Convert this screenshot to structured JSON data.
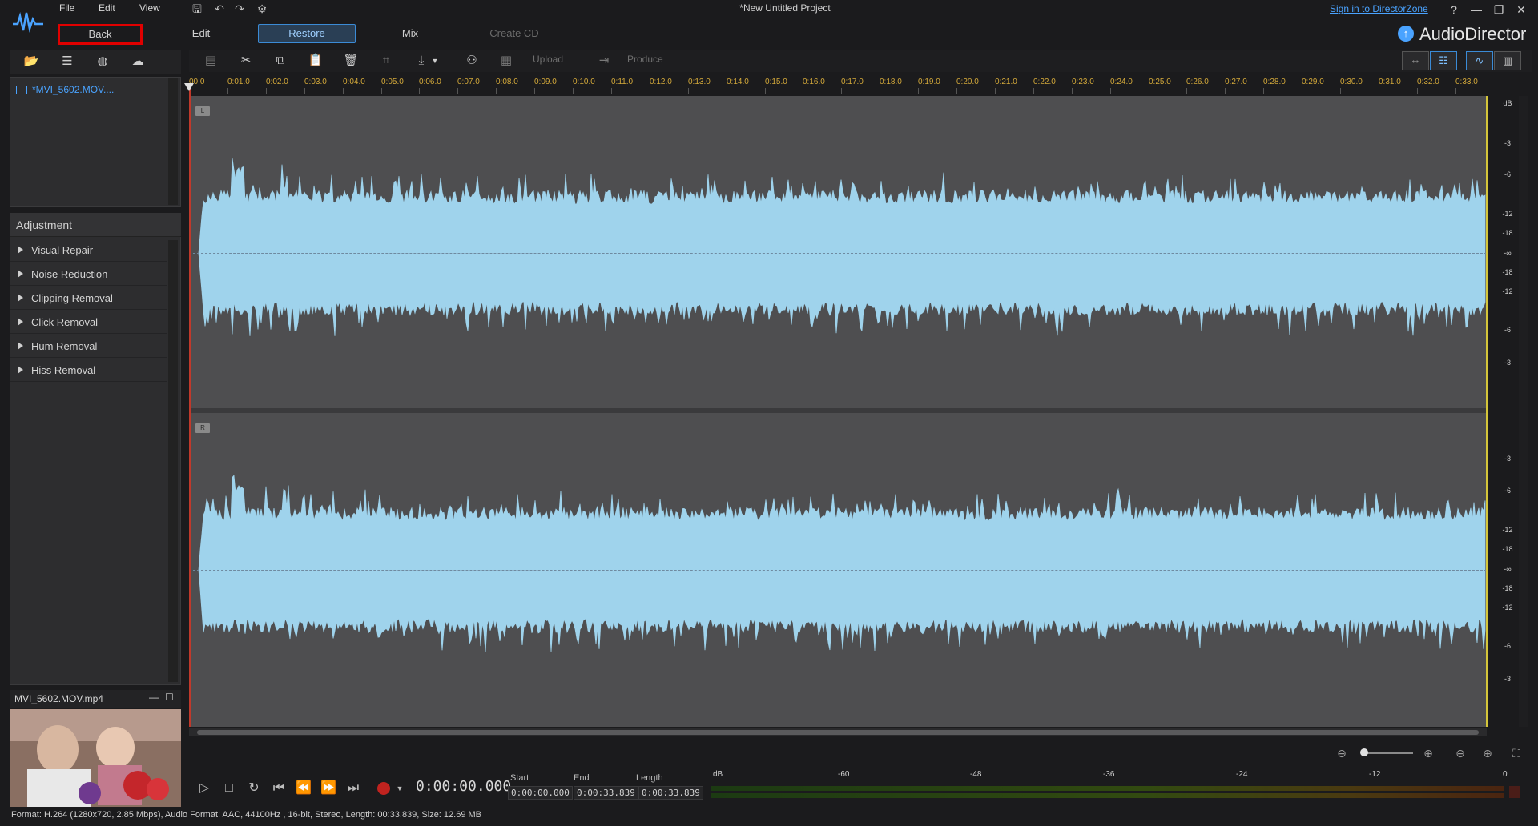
{
  "app": {
    "menu": [
      "File",
      "Edit",
      "View"
    ],
    "project_title": "*New Untitled Project",
    "sign_in": "Sign in to DirectorZone",
    "help": "?",
    "brand": "AudioDirector"
  },
  "modes": {
    "back": "Back",
    "edit": "Edit",
    "restore": "Restore",
    "mix": "Mix",
    "create_cd": "Create CD"
  },
  "library": {
    "item": "*MVI_5602.MOV...."
  },
  "adjustment": {
    "header": "Adjustment",
    "items": [
      "Visual Repair",
      "Noise Reduction",
      "Clipping Removal",
      "Click Removal",
      "Hum Removal",
      "Hiss Removal"
    ]
  },
  "preview": {
    "filename": "MVI_5602.MOV.mp4"
  },
  "toolbar": {
    "upload": "Upload",
    "produce": "Produce"
  },
  "ruler": {
    "labels": [
      "00:0",
      "0:01.0",
      "0:02.0",
      "0:03.0",
      "0:04.0",
      "0:05.0",
      "0:06.0",
      "0:07.0",
      "0:08.0",
      "0:09.0",
      "0:10.0",
      "0:11.0",
      "0:12.0",
      "0:13.0",
      "0:14.0",
      "0:15.0",
      "0:16.0",
      "0:17.0",
      "0:18.0",
      "0:19.0",
      "0:20.0",
      "0:21.0",
      "0:22.0",
      "0:23.0",
      "0:24.0",
      "0:25.0",
      "0:26.0",
      "0:27.0",
      "0:28.0",
      "0:29.0",
      "0:30.0",
      "0:31.0",
      "0:32.0",
      "0:33.0"
    ]
  },
  "channels": {
    "left": "L",
    "right": "R",
    "db_header": "dB",
    "db_scale": [
      "-3",
      "-6",
      "-12",
      "-18",
      "-∞",
      "-18",
      "-12",
      "-6",
      "-3"
    ]
  },
  "transport": {
    "timecode": "0:00:00.000",
    "start_label": "Start",
    "end_label": "End",
    "length_label": "Length",
    "start": "0:00:00.000",
    "end": "0:00:33.839",
    "length": "0:00:33.839"
  },
  "meter": {
    "labels": [
      "dB",
      "-60",
      "-48",
      "-36",
      "-24",
      "-12",
      "0"
    ]
  },
  "status": "Format: H.264 (1280x720, 2.85 Mbps), Audio Format: AAC, 44100Hz , 16-bit, Stereo, Length: 00:33.839, Size: 12.69 MB",
  "colors": {
    "waveform": "#9fd3ec",
    "accent": "#3b8bd6",
    "highlight_border": "#e00000",
    "ruler_text": "#d4a93a"
  }
}
